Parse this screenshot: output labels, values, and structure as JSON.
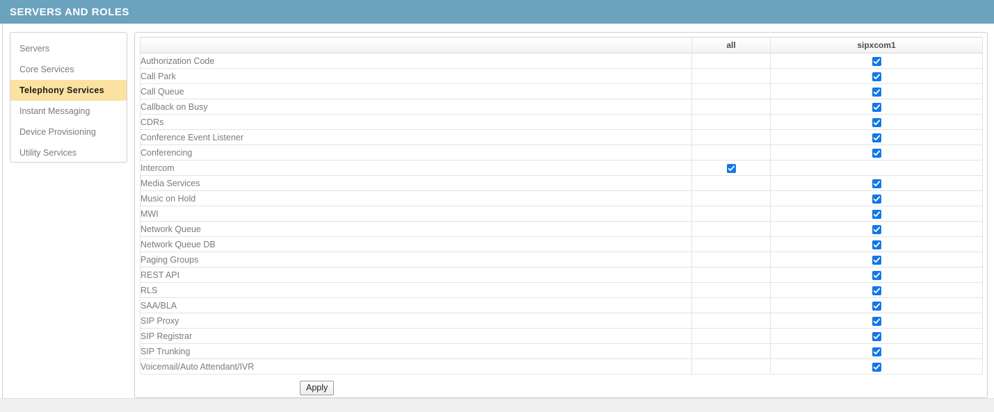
{
  "header": {
    "title": "SERVERS AND ROLES",
    "bar_color": "#6ba2bd"
  },
  "sidebar": {
    "items": [
      {
        "label": "Servers",
        "active": false
      },
      {
        "label": "Core Services",
        "active": false
      },
      {
        "label": "Telephony Services",
        "active": true
      },
      {
        "label": "Instant Messaging",
        "active": false
      },
      {
        "label": "Device Provisioning",
        "active": false
      },
      {
        "label": "Utility Services",
        "active": false
      }
    ],
    "active_highlight_color": "#fbe2a0"
  },
  "main": {
    "table": {
      "columns": [
        {
          "key": "name",
          "label": ""
        },
        {
          "key": "all",
          "label": "all"
        },
        {
          "key": "sipxcom1",
          "label": "sipxcom1"
        }
      ],
      "checkbox_color": "#1277e8",
      "rows": [
        {
          "name": "Authorization Code",
          "all": false,
          "sipxcom1": true
        },
        {
          "name": "Call Park",
          "all": false,
          "sipxcom1": true
        },
        {
          "name": "Call Queue",
          "all": false,
          "sipxcom1": true
        },
        {
          "name": "Callback on Busy",
          "all": false,
          "sipxcom1": true
        },
        {
          "name": "CDRs",
          "all": false,
          "sipxcom1": true
        },
        {
          "name": "Conference Event Listener",
          "all": false,
          "sipxcom1": true
        },
        {
          "name": "Conferencing",
          "all": false,
          "sipxcom1": true
        },
        {
          "name": "Intercom",
          "all": true,
          "sipxcom1": false
        },
        {
          "name": "Media Services",
          "all": false,
          "sipxcom1": true
        },
        {
          "name": "Music on Hold",
          "all": false,
          "sipxcom1": true
        },
        {
          "name": "MWI",
          "all": false,
          "sipxcom1": true
        },
        {
          "name": "Network Queue",
          "all": false,
          "sipxcom1": true
        },
        {
          "name": "Network Queue DB",
          "all": false,
          "sipxcom1": true
        },
        {
          "name": "Paging Groups",
          "all": false,
          "sipxcom1": true
        },
        {
          "name": "REST API",
          "all": false,
          "sipxcom1": true
        },
        {
          "name": "RLS",
          "all": false,
          "sipxcom1": true
        },
        {
          "name": "SAA/BLA",
          "all": false,
          "sipxcom1": true
        },
        {
          "name": "SIP Proxy",
          "all": false,
          "sipxcom1": true
        },
        {
          "name": "SIP Registrar",
          "all": false,
          "sipxcom1": true
        },
        {
          "name": "SIP Trunking",
          "all": false,
          "sipxcom1": true
        },
        {
          "name": "Voicemail/Auto Attendant/IVR",
          "all": false,
          "sipxcom1": true
        }
      ]
    },
    "apply_label": "Apply"
  }
}
